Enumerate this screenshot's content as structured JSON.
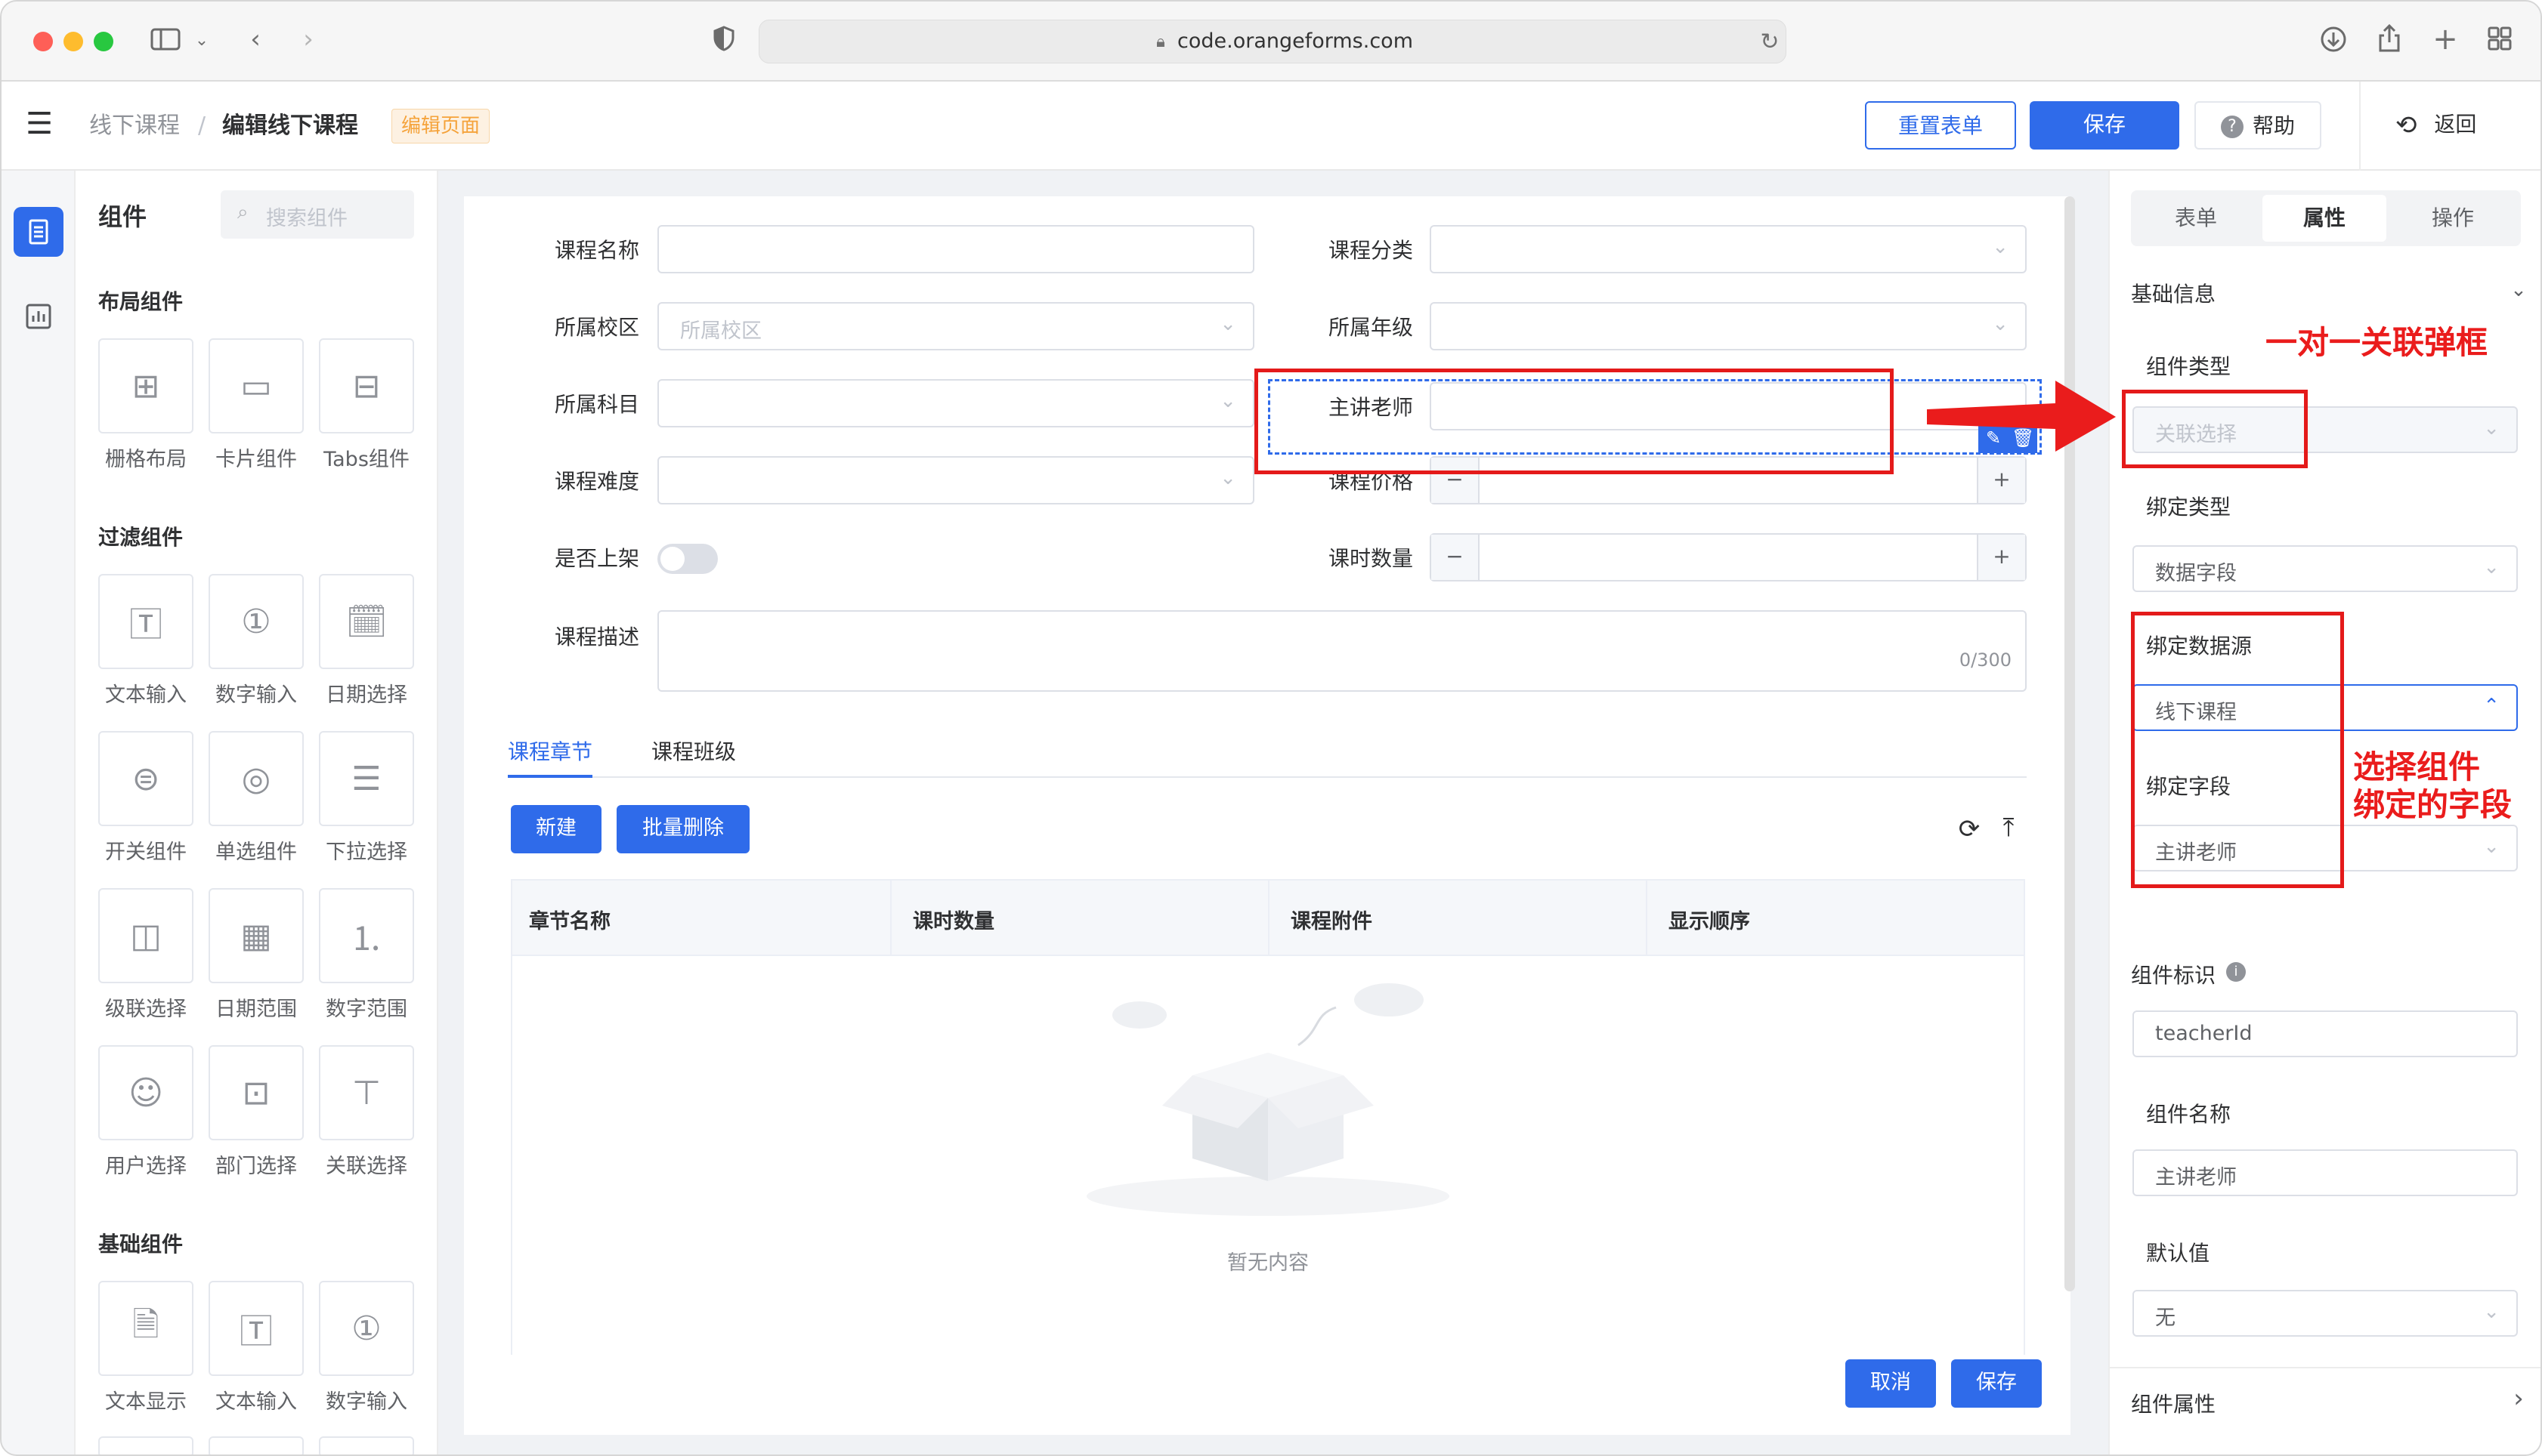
{
  "browser": {
    "url": "code.orangeforms.com"
  },
  "header": {
    "breadcrumb_root": "线下课程",
    "breadcrumb_sep": "/",
    "breadcrumb_current": "编辑线下课程",
    "mode_tag": "编辑页面",
    "reset_label": "重置表单",
    "save_label": "保存",
    "help_label": "帮助",
    "back_label": "返回"
  },
  "components": {
    "title": "组件",
    "search_placeholder": "搜索组件",
    "sections": [
      {
        "title": "布局组件",
        "items": [
          "栅格布局",
          "卡片组件",
          "Tabs组件"
        ]
      },
      {
        "title": "过滤组件",
        "items": [
          "文本输入",
          "数字输入",
          "日期选择",
          "开关组件",
          "单选组件",
          "下拉选择",
          "级联选择",
          "日期范围",
          "数字范围",
          "用户选择",
          "部门选择",
          "关联选择"
        ]
      },
      {
        "title": "基础组件",
        "items": [
          "文本显示",
          "文本输入",
          "数字输入"
        ]
      }
    ]
  },
  "form": {
    "course_name": "课程名称",
    "course_category": "课程分类",
    "campus": "所属校区",
    "campus_placeholder": "所属校区",
    "grade": "所属年级",
    "subject": "所属科目",
    "teacher": "主讲老师",
    "difficulty": "课程难度",
    "price": "课程价格",
    "on_shelf": "是否上架",
    "hours": "课时数量",
    "description": "课程描述",
    "desc_counter": "0/300",
    "minus": "−",
    "plus": "+"
  },
  "tabs": [
    "课程章节",
    "课程班级"
  ],
  "table": {
    "new_label": "新建",
    "batch_delete_label": "批量删除",
    "columns": [
      "章节名称",
      "课时数量",
      "课程附件",
      "显示顺序"
    ],
    "empty_text": "暂无内容"
  },
  "footer": {
    "cancel_label": "取消",
    "save_label": "保存"
  },
  "props": {
    "tabs": [
      "表单",
      "属性",
      "操作"
    ],
    "basic_info": "基础信息",
    "component_type_label": "组件类型",
    "component_type_value": "关联选择",
    "bind_type_label": "绑定类型",
    "bind_type_value": "数据字段",
    "bind_source_label": "绑定数据源",
    "bind_source_value": "线下课程",
    "bind_field_label": "绑定字段",
    "bind_field_value": "主讲老师",
    "comp_id_label": "组件标识",
    "comp_id_value": "teacherId",
    "comp_name_label": "组件名称",
    "comp_name_value": "主讲老师",
    "default_label": "默认值",
    "default_value": "无",
    "comp_attr_label": "组件属性"
  },
  "annotations": {
    "note1": "一对一关联弹框",
    "note2_line1": "选择组件",
    "note2_line2": "绑定的字段"
  },
  "colors": {
    "primary": "#2f6bea",
    "annotation_red": "#e41a1a",
    "tag_orange": "#f5a33b"
  }
}
